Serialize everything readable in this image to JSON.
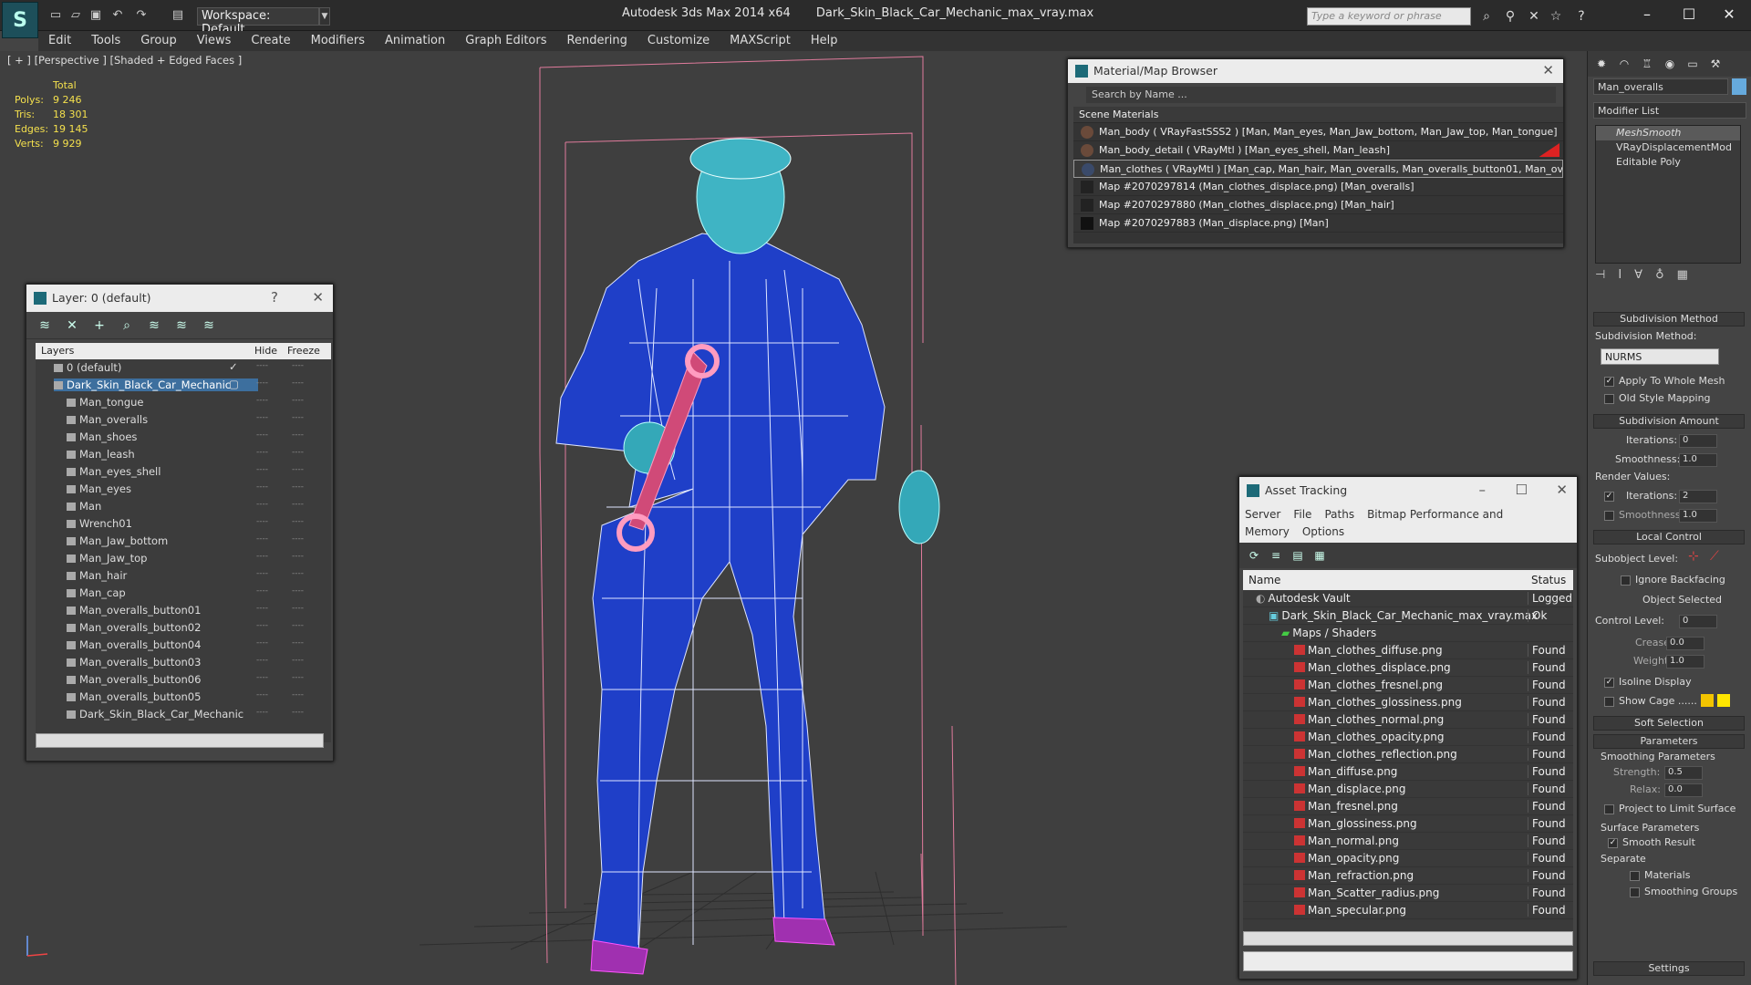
{
  "window": {
    "app_title": "Autodesk 3ds Max  2014 x64",
    "file_title": "Dark_Skin_Black_Car_Mechanic_max_vray.max",
    "workspace": "Workspace: Default",
    "search_placeholder": "Type a keyword or phrase"
  },
  "menu": [
    "Edit",
    "Tools",
    "Group",
    "Views",
    "Create",
    "Modifiers",
    "Animation",
    "Graph Editors",
    "Rendering",
    "Customize",
    "MAXScript",
    "Help"
  ],
  "viewport": {
    "label": "[ + ] [Perspective ] [Shaded + Edged Faces ]",
    "stats": {
      "header": "Total",
      "rows": [
        {
          "key": "Polys:",
          "value": "9 246"
        },
        {
          "key": "Tris:",
          "value": "18 301"
        },
        {
          "key": "Edges:",
          "value": "19 145"
        },
        {
          "key": "Verts:",
          "value": "9 929"
        }
      ]
    }
  },
  "layer_panel": {
    "title": "Layer: 0 (default)",
    "help": "?",
    "columns": {
      "layers": "Layers",
      "hide": "Hide",
      "freeze": "Freeze"
    },
    "rows": [
      {
        "name": "0 (default)",
        "level": 0
      },
      {
        "name": "Dark_Skin_Black_Car_Mechanic",
        "level": 0
      },
      {
        "name": "Man_tongue",
        "level": 1
      },
      {
        "name": "Man_overalls",
        "level": 1
      },
      {
        "name": "Man_shoes",
        "level": 1
      },
      {
        "name": "Man_leash",
        "level": 1
      },
      {
        "name": "Man_eyes_shell",
        "level": 1
      },
      {
        "name": "Man_eyes",
        "level": 1
      },
      {
        "name": "Man",
        "level": 1
      },
      {
        "name": "Wrench01",
        "level": 1
      },
      {
        "name": "Man_Jaw_bottom",
        "level": 1
      },
      {
        "name": "Man_Jaw_top",
        "level": 1
      },
      {
        "name": "Man_hair",
        "level": 1
      },
      {
        "name": "Man_cap",
        "level": 1
      },
      {
        "name": "Man_overalls_button01",
        "level": 1
      },
      {
        "name": "Man_overalls_button02",
        "level": 1
      },
      {
        "name": "Man_overalls_button04",
        "level": 1
      },
      {
        "name": "Man_overalls_button03",
        "level": 1
      },
      {
        "name": "Man_overalls_button06",
        "level": 1
      },
      {
        "name": "Man_overalls_button05",
        "level": 1
      },
      {
        "name": "Dark_Skin_Black_Car_Mechanic",
        "level": 1
      }
    ],
    "hide_marker": "----",
    "freeze_marker": "----"
  },
  "material_browser": {
    "title": "Material/Map Browser",
    "search": "Search by Name ...",
    "section": "Scene Materials",
    "rows": [
      "Man_body  ( VRayFastSSS2 ) [Man, Man_eyes, Man_Jaw_bottom, Man_Jaw_top, Man_tongue]",
      "Man_body_detail  ( VRayMtl ) [Man_eyes_shell, Man_leash]",
      "Man_clothes  ( VRayMtl ) [Man_cap, Man_hair, Man_overalls, Man_overalls_button01, Man_ov...",
      "Map #2070297814 (Man_clothes_displace.png) [Man_overalls]",
      "Map #2070297880 (Man_clothes_displace.png) [Man_hair]",
      "Map #2070297883 (Man_displace.png) [Man]"
    ]
  },
  "asset_tracking": {
    "title": "Asset Tracking",
    "menu": [
      "Server",
      "File",
      "Paths",
      "Bitmap Performance and Memory",
      "Options"
    ],
    "columns": {
      "name": "Name",
      "status": "Status"
    },
    "rows": [
      {
        "name": "Autodesk Vault",
        "status": "Logged Out",
        "level": 1
      },
      {
        "name": "Dark_Skin_Black_Car_Mechanic_max_vray.max",
        "status": "Ok",
        "level": 2
      },
      {
        "name": "Maps / Shaders",
        "status": "",
        "level": 3
      },
      {
        "name": "Man_clothes_diffuse.png",
        "status": "Found",
        "level": 4
      },
      {
        "name": "Man_clothes_displace.png",
        "status": "Found",
        "level": 4
      },
      {
        "name": "Man_clothes_fresnel.png",
        "status": "Found",
        "level": 4
      },
      {
        "name": "Man_clothes_glossiness.png",
        "status": "Found",
        "level": 4
      },
      {
        "name": "Man_clothes_normal.png",
        "status": "Found",
        "level": 4
      },
      {
        "name": "Man_clothes_opacity.png",
        "status": "Found",
        "level": 4
      },
      {
        "name": "Man_clothes_reflection.png",
        "status": "Found",
        "level": 4
      },
      {
        "name": "Man_diffuse.png",
        "status": "Found",
        "level": 4
      },
      {
        "name": "Man_displace.png",
        "status": "Found",
        "level": 4
      },
      {
        "name": "Man_fresnel.png",
        "status": "Found",
        "level": 4
      },
      {
        "name": "Man_glossiness.png",
        "status": "Found",
        "level": 4
      },
      {
        "name": "Man_normal.png",
        "status": "Found",
        "level": 4
      },
      {
        "name": "Man_opacity.png",
        "status": "Found",
        "level": 4
      },
      {
        "name": "Man_refraction.png",
        "status": "Found",
        "level": 4
      },
      {
        "name": "Man_Scatter_radius.png",
        "status": "Found",
        "level": 4
      },
      {
        "name": "Man_specular.png",
        "status": "Found",
        "level": 4
      }
    ]
  },
  "command_panel": {
    "object_name": "Man_overalls",
    "modifier_list": "Modifier List",
    "stack": [
      "MeshSmooth",
      "VRayDisplacementMod",
      "Editable Poly"
    ],
    "subdivision_method": {
      "rollout": "Subdivision Method",
      "label": "Subdivision Method:",
      "value": "NURMS",
      "apply_whole_mesh": "Apply To Whole Mesh",
      "old_style": "Old Style Mapping"
    },
    "subdivision_amount": {
      "rollout": "Subdivision Amount",
      "iterations_label": "Iterations:",
      "iterations": "0",
      "smoothness_label": "Smoothness:",
      "smoothness": "1.0",
      "render_values": "Render Values:",
      "render_iterations_label": "Iterations:",
      "render_iterations": "2",
      "render_smoothness_label": "Smoothness:",
      "render_smoothness": "1.0"
    },
    "local_control": {
      "rollout": "Local Control",
      "subobject_level": "Subobject Level:",
      "ignore_backfacing": "Ignore Backfacing",
      "object_selected": "Object Selected",
      "control_level_label": "Control Level:",
      "control_level": "0",
      "crease_label": "Crease:",
      "crease": "0.0",
      "weight_label": "Weight:",
      "weight": "1.0",
      "isoline": "Isoline Display",
      "show_cage": "Show Cage ......"
    },
    "soft_selection": "Soft Selection",
    "parameters": {
      "rollout": "Parameters",
      "smoothing": "Smoothing Parameters",
      "strength_label": "Strength:",
      "strength": "0.5",
      "relax_label": "Relax:",
      "relax": "0.0",
      "project": "Project to Limit Surface",
      "surface": "Surface Parameters",
      "smooth_result": "Smooth Result",
      "separate": "Separate",
      "materials": "Materials",
      "smoothing_groups": "Smoothing Groups"
    },
    "settings": "Settings"
  },
  "colors": {
    "accent": "#3d6f9e",
    "stats": "#f4e04d",
    "wire": "#ffffff",
    "body": "#1f3fc8"
  }
}
